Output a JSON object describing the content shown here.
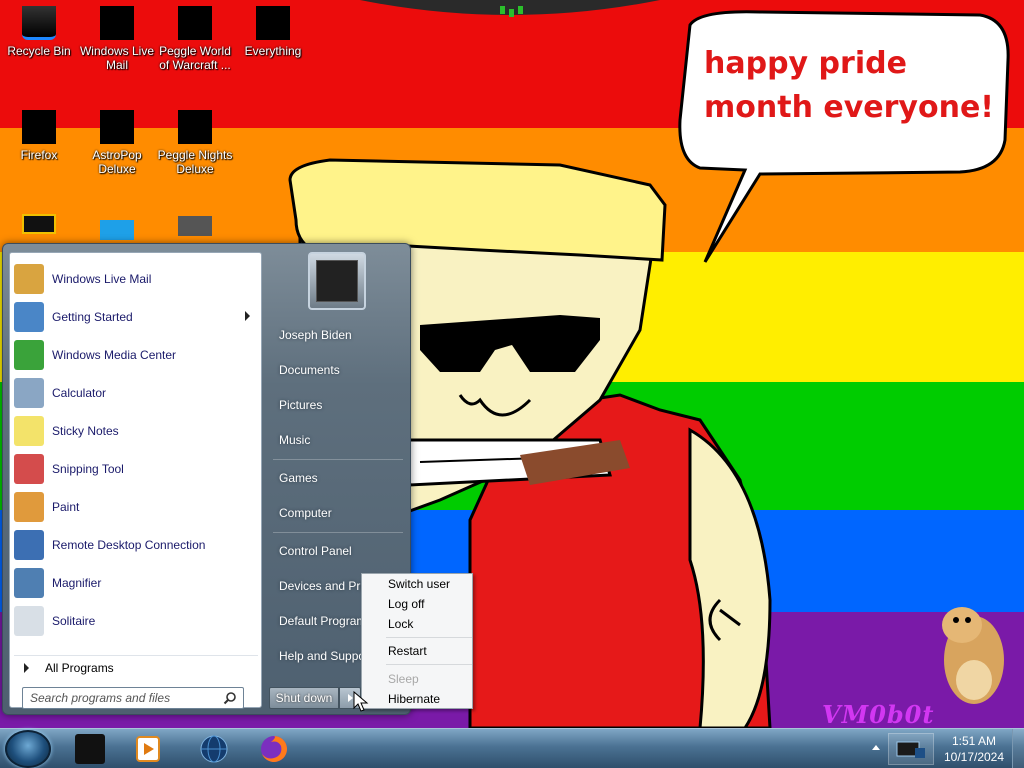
{
  "colors": {
    "stripe_red": "#ec0c0c",
    "stripe_orange": "#ff8c00",
    "stripe_yellow": "#ffee00",
    "stripe_green": "#00cc00",
    "stripe_blue": "#0066ff",
    "stripe_purple": "#7a1aa8",
    "bubble_text": "#e01818",
    "watermark": "#e23dff",
    "skin": "#f9f2c2",
    "hat": "#fff38a",
    "shirt": "#e61919",
    "cigar": "#8a4b2d"
  },
  "wallpaper": {
    "speech_bubble_text": "happy pride month everyone!",
    "watermark_text": "VM0b0t"
  },
  "desktop_icons": [
    {
      "label": "Recycle Bin",
      "icon": "recycle-bin-icon"
    },
    {
      "label": "Windows Live Mail",
      "icon": "mail-icon"
    },
    {
      "label": "Peggle World of Warcraft ...",
      "icon": "peggle-icon"
    },
    {
      "label": "Everything",
      "icon": "search-everything-icon"
    },
    {
      "label": "Firefox",
      "icon": "firefox-icon"
    },
    {
      "label": "AstroPop Deluxe",
      "icon": "astropop-icon"
    },
    {
      "label": "Peggle Nights Deluxe",
      "icon": "peggle-nights-icon"
    }
  ],
  "start_menu": {
    "programs": [
      {
        "label": "Windows Live Mail",
        "icon": "mail-icon",
        "color": "#d9a440"
      },
      {
        "label": "Getting Started",
        "icon": "getting-started-icon",
        "color": "#4a86c7",
        "submenu": true
      },
      {
        "label": "Windows Media Center",
        "icon": "media-center-icon",
        "color": "#3aa33a"
      },
      {
        "label": "Calculator",
        "icon": "calculator-icon",
        "color": "#8aa6c4"
      },
      {
        "label": "Sticky Notes",
        "icon": "sticky-notes-icon",
        "color": "#f3e36a"
      },
      {
        "label": "Snipping Tool",
        "icon": "snipping-tool-icon",
        "color": "#d44c4c"
      },
      {
        "label": "Paint",
        "icon": "paint-icon",
        "color": "#e09a3c"
      },
      {
        "label": "Remote Desktop Connection",
        "icon": "remote-desktop-icon",
        "color": "#3c6fb3"
      },
      {
        "label": "Magnifier",
        "icon": "magnifier-icon",
        "color": "#4f7fb2"
      },
      {
        "label": "Solitaire",
        "icon": "solitaire-icon",
        "color": "#d8dfe6"
      }
    ],
    "all_programs_label": "All Programs",
    "search_placeholder": "Search programs and files",
    "user_name": "Joseph Biden",
    "places": [
      {
        "label": "Documents"
      },
      {
        "label": "Pictures"
      },
      {
        "label": "Music"
      },
      {
        "label": "Games"
      },
      {
        "label": "Computer"
      },
      {
        "label": "Control Panel"
      },
      {
        "label": "Devices and Printers"
      },
      {
        "label": "Default Programs"
      },
      {
        "label": "Help and Support"
      }
    ],
    "shutdown_label": "Shut down"
  },
  "power_menu": {
    "items": [
      {
        "label": "Switch user",
        "enabled": true
      },
      {
        "label": "Log off",
        "enabled": true
      },
      {
        "label": "Lock",
        "enabled": true
      },
      {
        "label": "Restart",
        "enabled": true
      },
      {
        "label": "Sleep",
        "enabled": false
      },
      {
        "label": "Hibernate",
        "enabled": true
      }
    ]
  },
  "taskbar": {
    "pinned": [
      {
        "icon": "black-app-icon"
      },
      {
        "icon": "media-player-icon"
      },
      {
        "icon": "globe-icon"
      },
      {
        "icon": "firefox-icon"
      }
    ],
    "clock_time": "1:51 AM",
    "clock_date": "10/17/2024"
  }
}
